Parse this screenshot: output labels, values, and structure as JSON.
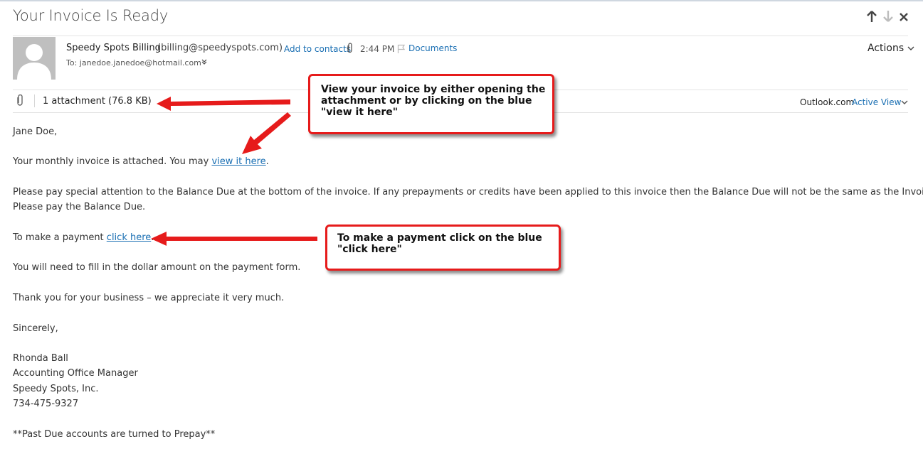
{
  "email": {
    "subject": "Your Invoice Is Ready",
    "sender_name": "Speedy Spots Billing",
    "sender_email": "(billing@speedyspots.com)",
    "add_contacts": "Add to contacts",
    "time": "2:44 PM",
    "documents": "Documents",
    "to": "To: janedoe.janedoe@hotmail.com",
    "actions": "Actions",
    "attachment": "1 attachment (76.8 KB)",
    "outlook": "Outlook.com",
    "active_view": "Active View"
  },
  "body": {
    "greeting": "Jane Doe,",
    "invoice_prefix": "Your monthly invoice is attached. You may ",
    "invoice_link": "view it here",
    "invoice_suffix": ".",
    "para1_line1": "Please pay special attention to the Balance Due at the bottom of the invoice. If any prepayments or credits have been applied to this invoice then the Balance Due will not be the same as the Invoice Total.",
    "para1_line2": "Please pay the Balance Due.",
    "payment_prefix": "To make a payment ",
    "payment_link": "click here",
    "payment_suffix": ".",
    "fill_in": "You will need to fill in the dollar amount on the payment form.",
    "thanks": "Thank you for your business – we appreciate it very much.",
    "sincerely": "Sincerely,",
    "sig_name": "Rhonda Ball",
    "sig_title": "Accounting Office Manager",
    "sig_company": "Speedy Spots, Inc.",
    "sig_phone": "734-475-9327",
    "note": "**Past Due accounts are turned to Prepay**"
  },
  "callouts": {
    "view_line1": "View your invoice by either opening the",
    "view_line2": "attachment or by clicking on the blue",
    "view_line3": "\"view it here\"",
    "pay_line1": "To make a payment click on the blue",
    "pay_line2": "\"click here\""
  },
  "icons": {
    "up": "up-arrow-icon",
    "down": "down-arrow-icon",
    "close": "close-icon",
    "paperclip": "paperclip-icon",
    "flag": "flag-icon"
  },
  "colors": {
    "link": "#1a6fb3",
    "callout_border": "#e61b1b",
    "arrow": "#e61b1b"
  }
}
